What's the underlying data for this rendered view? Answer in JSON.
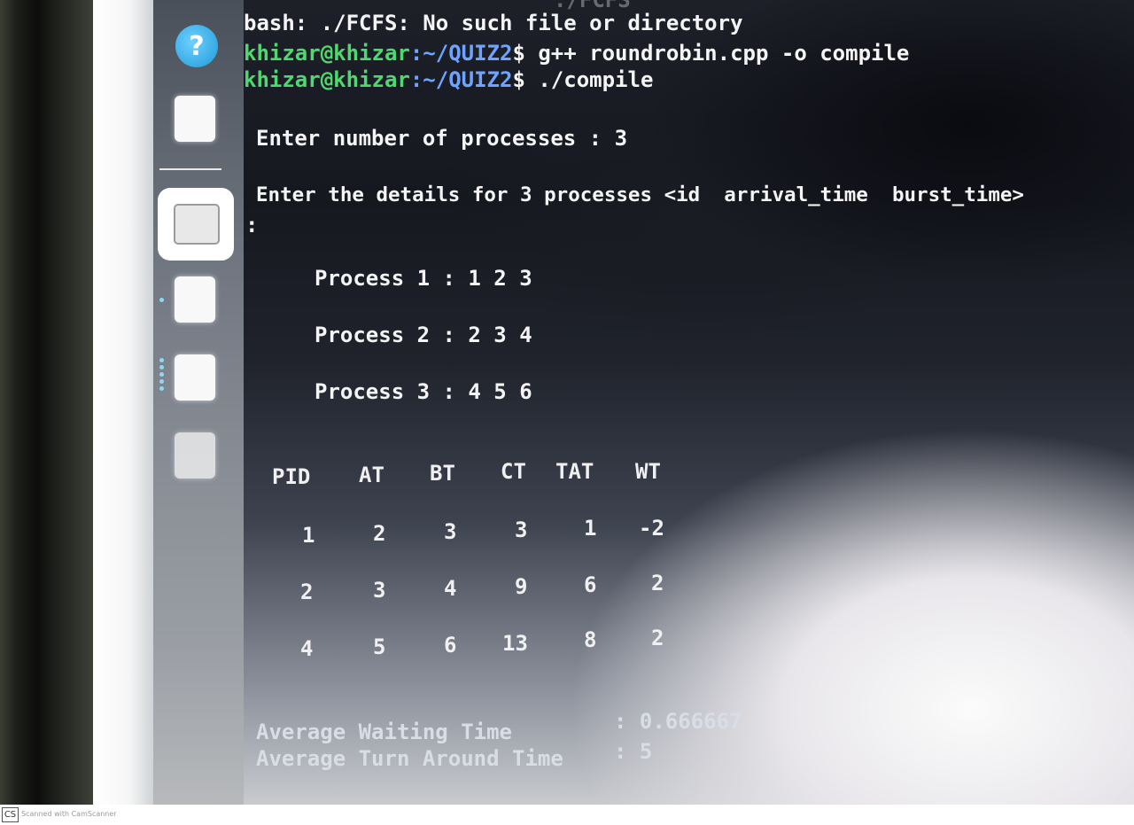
{
  "terminal": {
    "line0_cmd": "./FCFS",
    "error_line": "bash: ./FCFS: No such file or directory",
    "prompt_user": "khizar@khizar",
    "prompt_path": ":~/QUIZ2",
    "prompt_symbol": "$",
    "cmd_compile": "g++ roundrobin.cpp -o compile",
    "cmd_run": "./compile",
    "enter_count": "Enter number of processes : 3",
    "enter_details": "Enter the details for 3 processes <id  arrival_time  burst_time>",
    "colon": ":",
    "processes": [
      "Process 1 : 1 2 3",
      "Process 2 : 2 3 4",
      "Process 3 : 4 5 6"
    ],
    "table": {
      "headers": [
        "PID",
        "AT",
        "BT",
        "CT",
        "TAT",
        "WT"
      ],
      "rows": [
        [
          "1",
          "2",
          "3",
          "3",
          "1",
          "-2"
        ],
        [
          "2",
          "3",
          "4",
          "9",
          "6",
          "2"
        ],
        [
          "4",
          "5",
          "6",
          "13",
          "8",
          "2"
        ]
      ]
    },
    "avg_waiting_label": "Average Waiting Time",
    "avg_waiting_value": ": 0.666667",
    "avg_tat_label": "Average Turn Around Time",
    "avg_tat_value": ": 5"
  },
  "dock": {
    "help_glyph": "?"
  },
  "footer": {
    "logo": "CS",
    "text": "Scanned with CamScanner"
  },
  "colors": {
    "prompt_user": "#4fd870",
    "prompt_path": "#6ea4ff",
    "text": "#f4f4f4"
  }
}
